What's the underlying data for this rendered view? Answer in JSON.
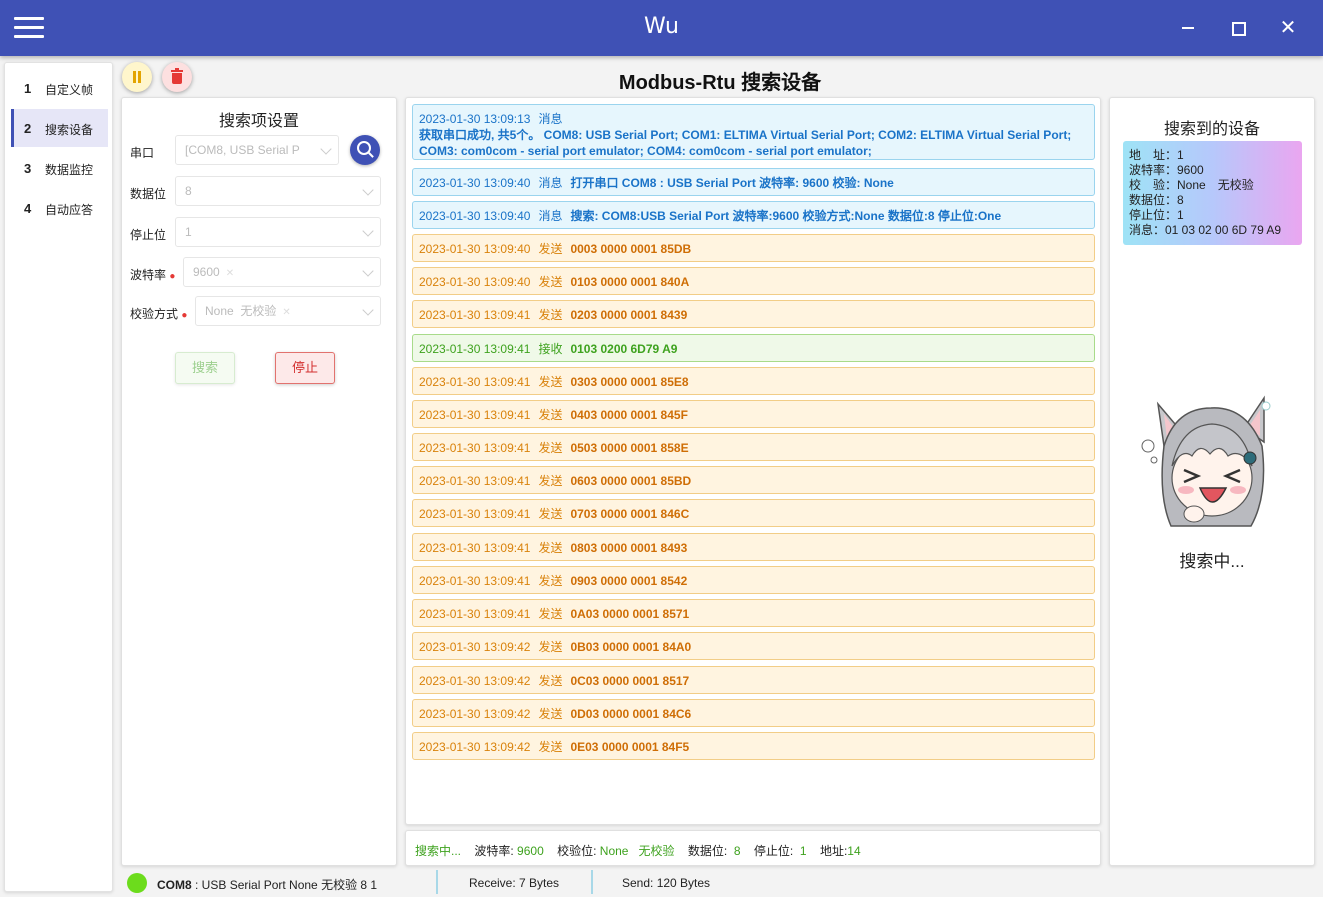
{
  "app": {
    "title": "Wu",
    "close_glyph": "✕"
  },
  "nav": {
    "items": [
      {
        "num": "1",
        "label": "自定义帧",
        "active": false
      },
      {
        "num": "2",
        "label": "搜索设备",
        "active": true
      },
      {
        "num": "3",
        "label": "数据监控",
        "active": false
      },
      {
        "num": "4",
        "label": "自动应答",
        "active": false
      }
    ]
  },
  "page": {
    "title": "Modbus-Rtu 搜索设备"
  },
  "settings": {
    "title": "搜索项设置",
    "port_label": "串口",
    "port_value": "[COM8, USB Serial P",
    "databits_label": "数据位",
    "databits_value": "8",
    "stopbits_label": "停止位",
    "stopbits_value": "1",
    "baud_label": "波特率",
    "baud_value": "9600",
    "parity_label": "校验方式",
    "parity_value1": "None",
    "parity_value2": "无校验",
    "required_mark": "●",
    "tag_close": "✕",
    "search_button": "搜索",
    "stop_button": "停止"
  },
  "log": [
    {
      "type": "info",
      "ts": "2023-01-30 13:09:13",
      "kind": "消息",
      "msg": "获取串口成功, 共5个。  COM8: USB Serial Port;   COM1: ELTIMA Virtual Serial Port;   COM2: ELTIMA Virtual Serial Port;   COM3: com0com - serial port emulator;   COM4: com0com - serial port emulator;",
      "multiline": true
    },
    {
      "type": "info",
      "ts": "2023-01-30 13:09:40",
      "kind": "消息",
      "msg": "打开串口 COM8 : USB Serial Port  波特率: 9600 校验: None"
    },
    {
      "type": "info",
      "ts": "2023-01-30 13:09:40",
      "kind": "消息",
      "msg": "搜索: COM8:USB Serial Port 波特率:9600 校验方式:None 数据位:8 停止位:One"
    },
    {
      "type": "send",
      "ts": "2023-01-30 13:09:40",
      "kind": "发送",
      "msg": "0003 0000 0001 85DB"
    },
    {
      "type": "send",
      "ts": "2023-01-30 13:09:40",
      "kind": "发送",
      "msg": "0103 0000 0001 840A"
    },
    {
      "type": "send",
      "ts": "2023-01-30 13:09:41",
      "kind": "发送",
      "msg": "0203 0000 0001 8439"
    },
    {
      "type": "recv",
      "ts": "2023-01-30 13:09:41",
      "kind": "接收",
      "msg": "0103 0200 6D79 A9"
    },
    {
      "type": "send",
      "ts": "2023-01-30 13:09:41",
      "kind": "发送",
      "msg": "0303 0000 0001 85E8"
    },
    {
      "type": "send",
      "ts": "2023-01-30 13:09:41",
      "kind": "发送",
      "msg": "0403 0000 0001 845F"
    },
    {
      "type": "send",
      "ts": "2023-01-30 13:09:41",
      "kind": "发送",
      "msg": "0503 0000 0001 858E"
    },
    {
      "type": "send",
      "ts": "2023-01-30 13:09:41",
      "kind": "发送",
      "msg": "0603 0000 0001 85BD"
    },
    {
      "type": "send",
      "ts": "2023-01-30 13:09:41",
      "kind": "发送",
      "msg": "0703 0000 0001 846C"
    },
    {
      "type": "send",
      "ts": "2023-01-30 13:09:41",
      "kind": "发送",
      "msg": "0803 0000 0001 8493"
    },
    {
      "type": "send",
      "ts": "2023-01-30 13:09:41",
      "kind": "发送",
      "msg": "0903 0000 0001 8542"
    },
    {
      "type": "send",
      "ts": "2023-01-30 13:09:41",
      "kind": "发送",
      "msg": "0A03 0000 0001 8571"
    },
    {
      "type": "send",
      "ts": "2023-01-30 13:09:42",
      "kind": "发送",
      "msg": "0B03 0000 0001 84A0"
    },
    {
      "type": "send",
      "ts": "2023-01-30 13:09:42",
      "kind": "发送",
      "msg": "0C03 0000 0001 8517"
    },
    {
      "type": "send",
      "ts": "2023-01-30 13:09:42",
      "kind": "发送",
      "msg": "0D03 0000 0001 84C6"
    },
    {
      "type": "send",
      "ts": "2023-01-30 13:09:42",
      "kind": "发送",
      "msg": "0E03 0000 0001 84F5"
    }
  ],
  "status": {
    "state": "搜索中...",
    "baud_label": "波特率:",
    "baud": "9600",
    "parity_label": "校验位:",
    "parity": "None",
    "parity_cn": "无校验",
    "databits_label": "数据位:",
    "databits": "8",
    "stopbits_label": "停止位:",
    "stopbits": "1",
    "addr_label": "地址:",
    "addr": "14"
  },
  "devices": {
    "title": "搜索到的设备",
    "card": {
      "addr_line": "地　址：1",
      "baud_line": "波特率：9600",
      "parity_line": "校　验：None　无校验",
      "databits_line": "数据位：8",
      "stopbits_line": "停止位：1",
      "msg_line": "消息：01 03 02 00 6D 79 A9"
    },
    "searching": "搜索中..."
  },
  "footer": {
    "port": "COM8",
    "port_desc": ": USB Serial Port  None  无校验  8  1",
    "receive": "Receive: 7 Bytes",
    "send": "Send: 120 Bytes",
    "status_color": "#6cdc1c"
  }
}
